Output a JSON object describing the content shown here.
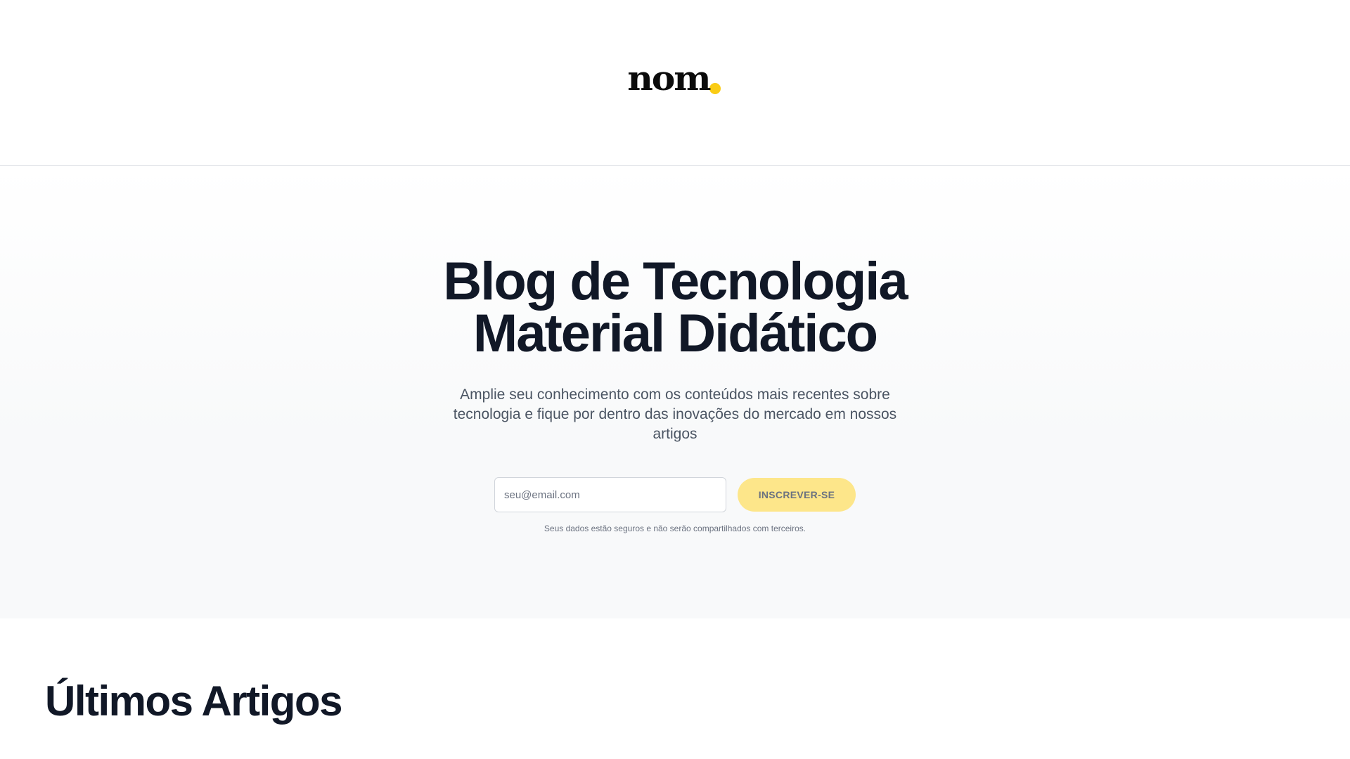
{
  "header": {
    "logo_text": "nom",
    "logo_dot_color": "#facc15"
  },
  "hero": {
    "title_line1": "Blog de Tecnologia",
    "title_line2": "Material Didático",
    "subtitle": "Amplie seu conhecimento com os conteúdos mais recentes sobre tecnologia e fique por dentro das inovações do mercado em nossos artigos",
    "email_placeholder": "seu@email.com",
    "email_value": "",
    "subscribe_label": "INSCREVER-SE",
    "subscribe_color": "#fde68a",
    "privacy_note": "Seus dados estão seguros e não serão compartilhados com terceiros."
  },
  "latest": {
    "title": "Últimos Artigos"
  }
}
